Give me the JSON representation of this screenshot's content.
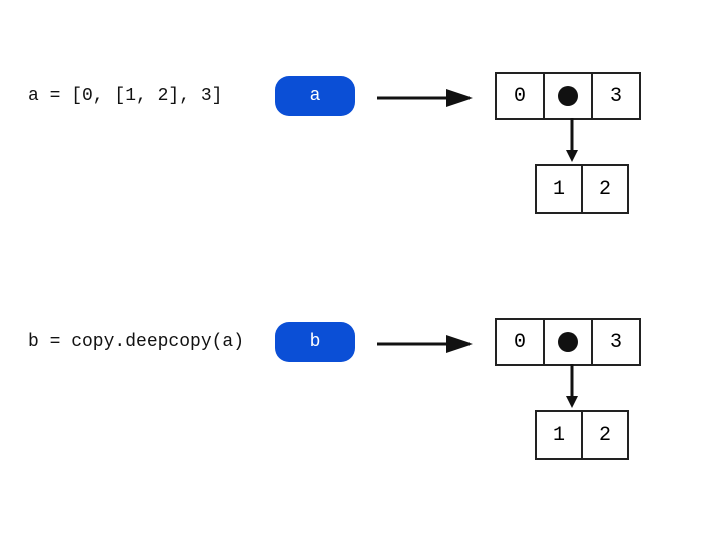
{
  "rows": [
    {
      "code": "a = [0, [1, 2], 3]",
      "pill": "a",
      "outer": [
        "0",
        "•",
        "3"
      ],
      "inner": [
        "1",
        "2"
      ]
    },
    {
      "code": "b = copy.deepcopy(a)",
      "pill": "b",
      "outer": [
        "0",
        "•",
        "3"
      ],
      "inner": [
        "1",
        "2"
      ]
    }
  ],
  "colors": {
    "pill": "#0b4fd6"
  }
}
